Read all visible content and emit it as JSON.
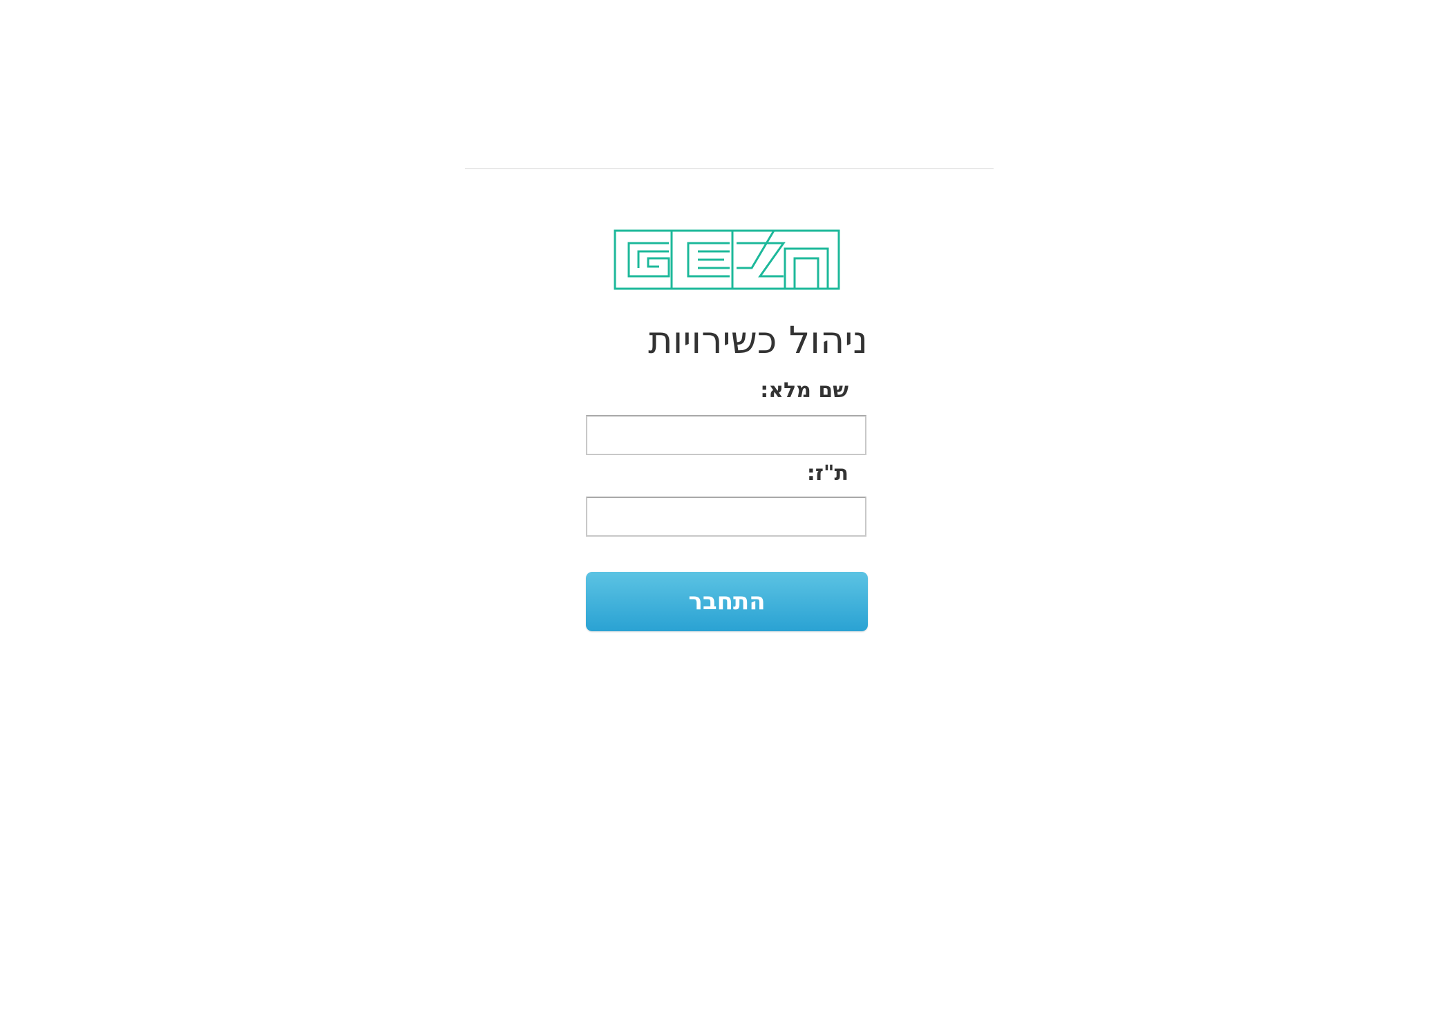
{
  "logo": {
    "text": "GEZn",
    "color": "#1cb89a"
  },
  "title": "ניהול כשירויות",
  "form": {
    "full_name_label": "שם מלא:",
    "full_name_value": "",
    "id_label": "ת\"ז:",
    "id_value": "",
    "submit_label": "התחבר"
  },
  "colors": {
    "button_top": "#5cc3e3",
    "button_bottom": "#2aa2d3",
    "text": "#333333"
  }
}
